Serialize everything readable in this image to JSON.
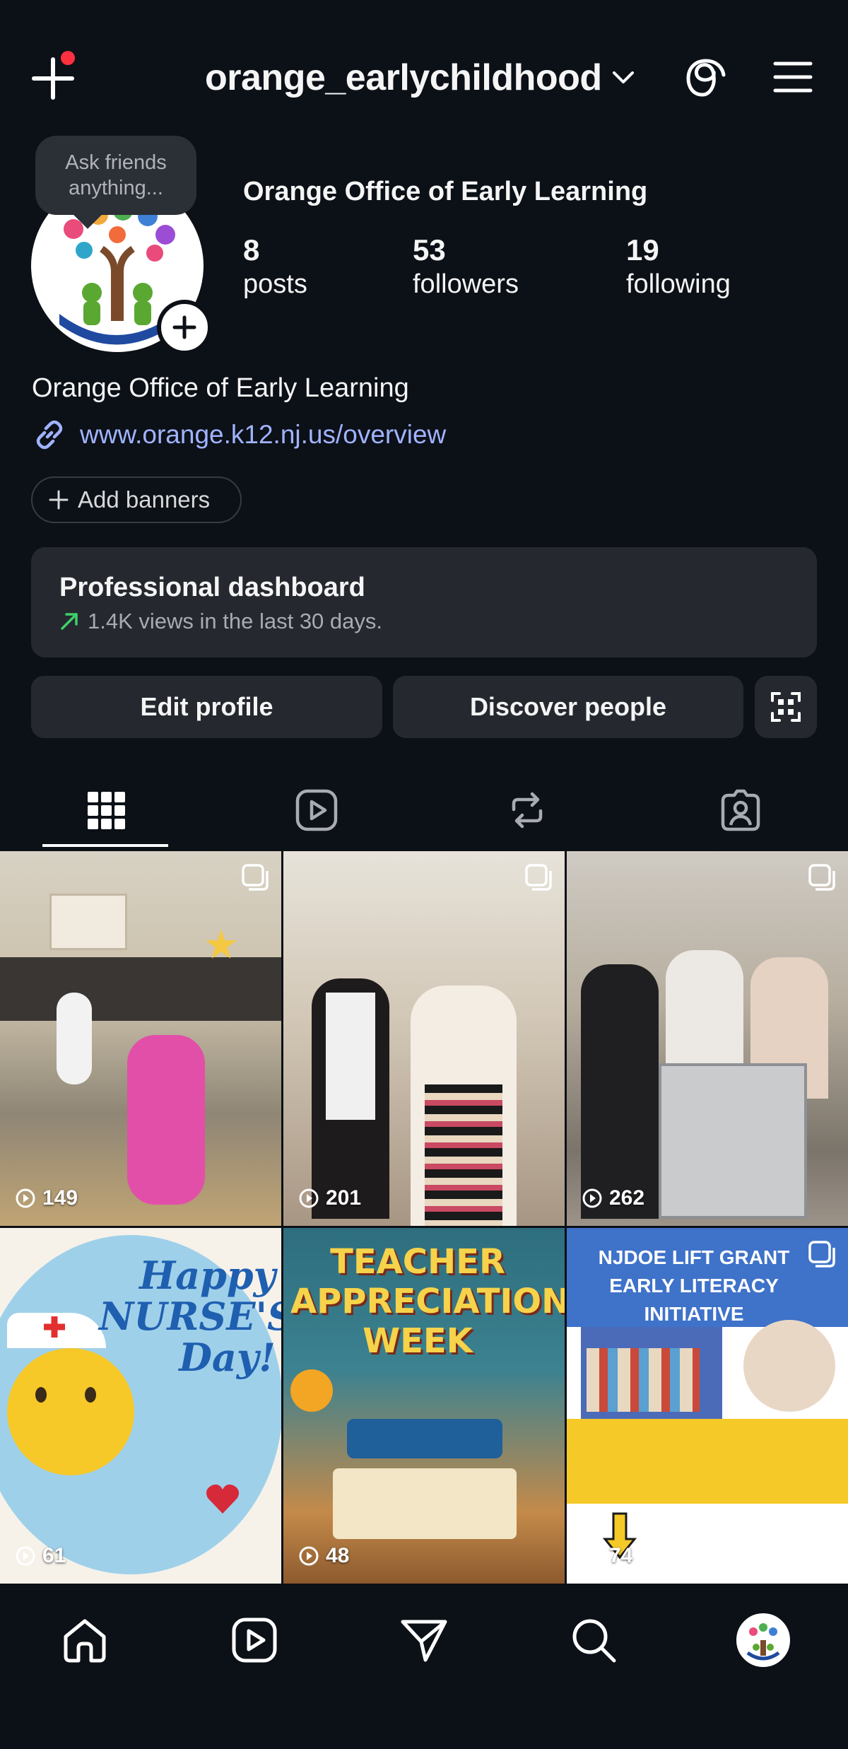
{
  "header": {
    "username": "orange_earlychildhood",
    "icons": [
      "plus-icon",
      "chevron-down-icon",
      "threads-icon",
      "menu-icon"
    ]
  },
  "profile": {
    "tooltip": "Ask friends anything...",
    "display_name": "Orange Office of Early Learning",
    "stats": [
      {
        "value": "8",
        "label": "posts"
      },
      {
        "value": "53",
        "label": "followers"
      },
      {
        "value": "19",
        "label": "following"
      }
    ],
    "bio_name": "Orange Office of Early Learning",
    "link": "www.orange.k12.nj.us/overview",
    "add_banners": "Add banners"
  },
  "dashboard": {
    "title": "Professional dashboard",
    "subtitle": "1.4K views in the last 30 days."
  },
  "actions": {
    "edit_profile": "Edit profile",
    "discover_people": "Discover people"
  },
  "tabs": [
    "grid-icon",
    "reels-icon",
    "reposts-icon",
    "tagged-icon"
  ],
  "posts": [
    {
      "views": "149",
      "caption": ""
    },
    {
      "views": "201",
      "caption": ""
    },
    {
      "views": "262",
      "caption": ""
    },
    {
      "views": "61",
      "caption": "Happy NURSE'S Day!"
    },
    {
      "views": "48",
      "caption": "TEACHER APPRECIATION WEEK"
    },
    {
      "views": "74",
      "caption": "NJDOE LIFT GRANT EARLY LITERACY INITIATIVE"
    }
  ],
  "bottom_nav": [
    "home-icon",
    "reels-icon",
    "messages-icon",
    "search-icon",
    "profile-avatar"
  ],
  "colors": {
    "background": "#0c1017",
    "card": "#25292f",
    "link": "#a0b3ff",
    "badge": "#ff3040"
  }
}
